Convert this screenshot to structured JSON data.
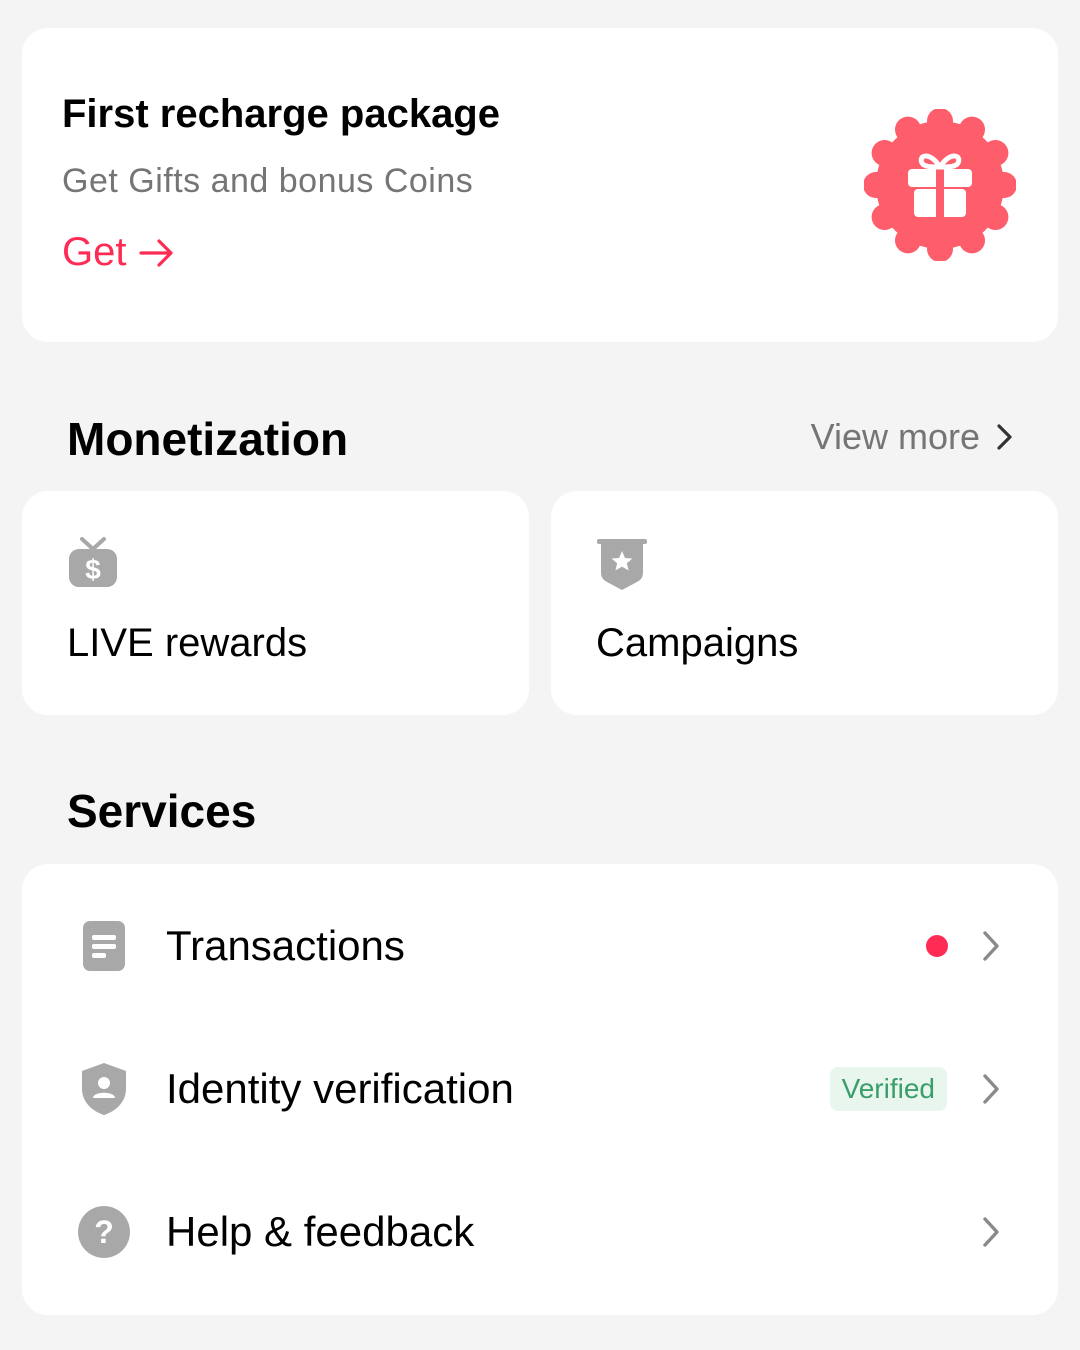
{
  "promo": {
    "title": "First recharge package",
    "subtitle": "Get Gifts and bonus Coins",
    "cta_label": "Get",
    "cta_icon": "arrow-right-icon",
    "badge_icon": "gift-icon",
    "accent_color": "#fe2c55",
    "badge_color": "#fe5d6b"
  },
  "monetization": {
    "title": "Monetization",
    "view_more_label": "View more",
    "tiles": [
      {
        "label": "LIVE rewards",
        "icon": "dollar-bag-icon"
      },
      {
        "label": "Campaigns",
        "icon": "star-banner-icon"
      }
    ]
  },
  "services": {
    "title": "Services",
    "items": [
      {
        "label": "Transactions",
        "icon": "document-icon",
        "indicator": "red-dot"
      },
      {
        "label": "Identity verification",
        "icon": "shield-user-icon",
        "badge": "Verified"
      },
      {
        "label": "Help & feedback",
        "icon": "question-icon"
      }
    ]
  },
  "colors": {
    "background": "#f4f4f4",
    "card": "#ffffff",
    "secondary_text": "#757575",
    "icon_gray": "#a8a8a8",
    "verified_bg": "#e8f6ee",
    "verified_text": "#3a9e6a"
  }
}
